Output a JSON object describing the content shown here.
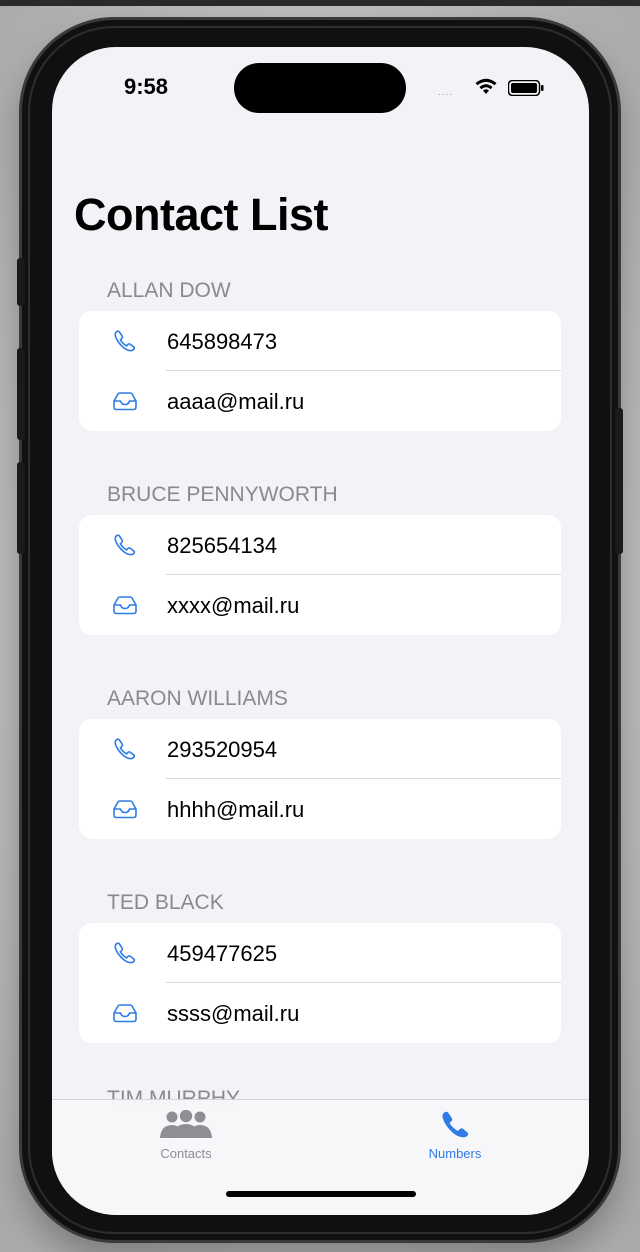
{
  "status_bar": {
    "time": "9:58",
    "signal": "....",
    "wifi_icon": "wifi-icon",
    "battery_icon": "battery-icon"
  },
  "page": {
    "title": "Contact List"
  },
  "contacts": [
    {
      "name": "ALLAN DOW",
      "phone": "645898473",
      "email": "aaaa@mail.ru"
    },
    {
      "name": "BRUCE PENNYWORTH",
      "phone": "825654134",
      "email": "xxxx@mail.ru"
    },
    {
      "name": "AARON WILLIAMS",
      "phone": "293520954",
      "email": "hhhh@mail.ru"
    },
    {
      "name": "TED BLACK",
      "phone": "459477625",
      "email": "ssss@mail.ru"
    }
  ],
  "partial_contact": {
    "name": "TIM MURPHY"
  },
  "tabs": [
    {
      "label": "Contacts",
      "icon": "people-icon",
      "selected": false
    },
    {
      "label": "Numbers",
      "icon": "phone-icon",
      "selected": true
    }
  ],
  "colors": {
    "accent": "#2f7ce5",
    "background": "#f2f2f7",
    "section_header": "#8a8a8e",
    "card": "#ffffff"
  }
}
